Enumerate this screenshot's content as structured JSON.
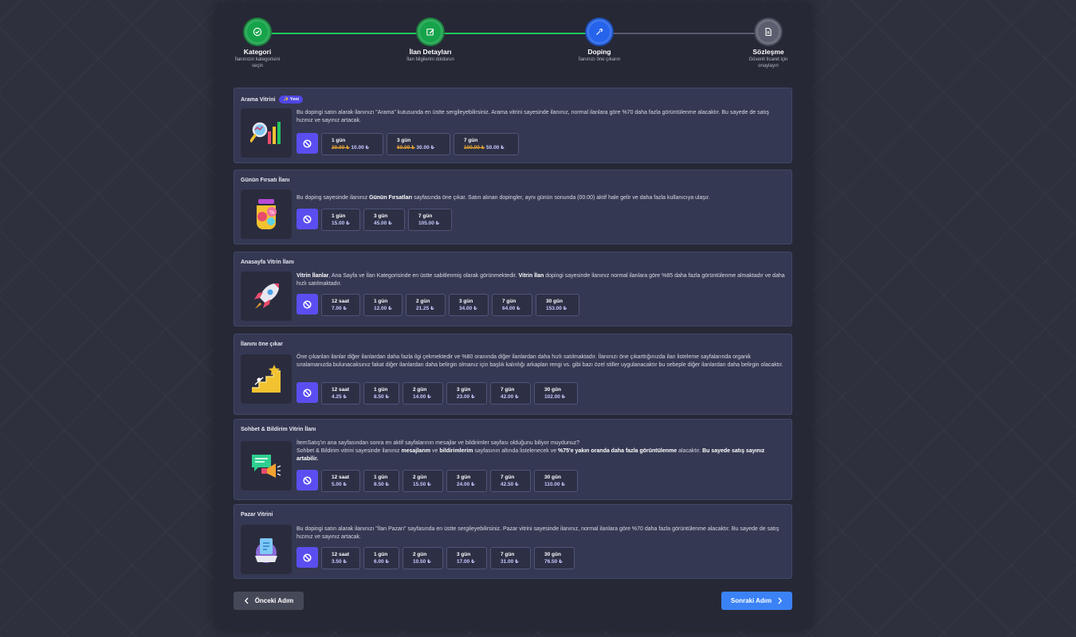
{
  "stepper": {
    "steps": [
      {
        "title": "Kategori",
        "sub": "İlanınızın kategorisini seçin",
        "state": "done",
        "icon": "check-icon"
      },
      {
        "title": "İlan Detayları",
        "sub": "İlan bilgilerini doldurun",
        "state": "done",
        "icon": "edit-icon"
      },
      {
        "title": "Doping",
        "sub": "İlanınızı öne çıkarın",
        "state": "active",
        "icon": "doping-icon"
      },
      {
        "title": "Sözleşme",
        "sub": "Güvenli ticaret için onaylayın",
        "state": "pending",
        "icon": "document-icon"
      }
    ]
  },
  "cards": [
    {
      "title": "Arama Vitrini",
      "badge": "✨ Yeni",
      "desc_html": "Bu dopingi satın alarak ilanınızı \"Arama\" kutusunda en üstte sergileyebilirsiniz. Arama vitrini sayesinde ilanınız, normal ilanlara göre %70 daha fazla görüntülenme alacaktır. Bu sayede de satış hızınız ve sayınız artacak.",
      "options": [
        {
          "label": "1 gün",
          "old": "20.00 ₺",
          "new": "10.00 ₺"
        },
        {
          "label": "3 gün",
          "old": "60.00 ₺",
          "new": "30.00 ₺"
        },
        {
          "label": "7 gün",
          "old": "100.00 ₺",
          "new": "50.00 ₺"
        }
      ]
    },
    {
      "title": "Günün Fırsatı İlanı",
      "desc_html": "Bu doping sayesinde ilanınız <b>Günün Fırsatları</b> sayfasında öne çıkar. Satın alınan dopingler, aynı günün sonunda (00:00) aktif hale gelir ve daha fazla kullanıcıya ulaşır.",
      "options": [
        {
          "label": "1 gün",
          "price": "15.00 ₺"
        },
        {
          "label": "3 gün",
          "price": "45.00 ₺"
        },
        {
          "label": "7 gün",
          "price": "105.00 ₺"
        }
      ]
    },
    {
      "title": "Anasayfa Vitrin İlanı",
      "desc_html": "<b>Vitrin İlanlar</b>, Ana Sayfa ve İlan Kategorisinde en üstte sabitlenmiş olarak görünmektedir. <b>Vitrin İlan</b> dopingi sayesinde ilanınız normal ilanlara göre %85 daha fazla görüntülenme almaktadır ve daha hızlı satılmaktadır.",
      "options": [
        {
          "label": "12 saat",
          "price": "7.00 ₺"
        },
        {
          "label": "1 gün",
          "price": "12.00 ₺"
        },
        {
          "label": "2 gün",
          "price": "21.25 ₺"
        },
        {
          "label": "3 gün",
          "price": "34.00 ₺"
        },
        {
          "label": "7 gün",
          "price": "64.00 ₺"
        },
        {
          "label": "30 gün",
          "price": "153.00 ₺"
        }
      ]
    },
    {
      "title": "İlanını öne çıkar",
      "desc_html": "Öne çıkanlan ilanlar diğer ilanlardan daha fazla ilgi çekmektedir ve %80 oranında diğer ilanlardan daha hızlı satılmaktadır. İlanınızı öne çıkarttığınızda ilan listeleme sayfalarında organik sıralamanızda bulunacaksınız fakat diğer ilanlardan daha belirgin olmanız için başlık kalınlığı arkaplan rengi vs. gibi bazı özel stiller uygulanacaktır bu sebeple diğer ilanlardan daha belirgin olacaktır.",
      "options": [
        {
          "label": "12 saat",
          "price": "4.25 ₺"
        },
        {
          "label": "1 gün",
          "price": "8.50 ₺"
        },
        {
          "label": "2 gün",
          "price": "14.00 ₺"
        },
        {
          "label": "3 gün",
          "price": "23.00 ₺"
        },
        {
          "label": "7 gün",
          "price": "42.00 ₺"
        },
        {
          "label": "30 gün",
          "price": "102.00 ₺"
        }
      ]
    },
    {
      "title": "Sohbet & Bildirim Vitrin İlanı",
      "desc_html": "İtemSatış'ın ana sayfasından sonra en aktif sayfalarının mesajlar ve bildirimler sayfası olduğunu biliyor muydunuz?<br>Sohbet & Bildirim vitrini sayesinde ilanınız <b>mesajlarım</b> ve <b>bildirimlerim</b> sayfasının altında listelenecek ve <b>%75'e yakın oranda daha fazla görüntülenme</b> alacaktır. <b>Bu sayede satış sayınız artabilir.</b>",
      "options": [
        {
          "label": "12 saat",
          "price": "5.00 ₺"
        },
        {
          "label": "1 gün",
          "price": "8.50 ₺"
        },
        {
          "label": "2 gün",
          "price": "15.50 ₺"
        },
        {
          "label": "3 gün",
          "price": "24.00 ₺"
        },
        {
          "label": "7 gün",
          "price": "42.50 ₺"
        },
        {
          "label": "30 gün",
          "price": "110.00 ₺"
        }
      ]
    },
    {
      "title": "Pazar Vitrini",
      "desc_html": "Bu dopingi satın alarak ilanınızı \"İlan Pazarı\" sayfasında en üstte sergileyebilirsiniz. Pazar vitrini sayesinde ilanınız, normal ilanlara göre %70 daha fazla görüntülenme alacaktır. Bu sayede de satış hızınız ve sayınız artacak.",
      "options": [
        {
          "label": "12 saat",
          "price": "3.50 ₺"
        },
        {
          "label": "1 gün",
          "price": "6.00 ₺"
        },
        {
          "label": "2 gün",
          "price": "10.50 ₺"
        },
        {
          "label": "3 gün",
          "price": "17.00 ₺"
        },
        {
          "label": "7 gün",
          "price": "31.00 ₺"
        },
        {
          "label": "30 gün",
          "price": "76.50 ₺"
        }
      ]
    }
  ],
  "nav": {
    "prev_label": "Önceki Adım",
    "next_label": "Sonraki Adım"
  },
  "colors": {
    "accent": "#5b4ef0",
    "done": "#16a34a",
    "active": "#2563eb",
    "next_button": "#3b82f6"
  }
}
